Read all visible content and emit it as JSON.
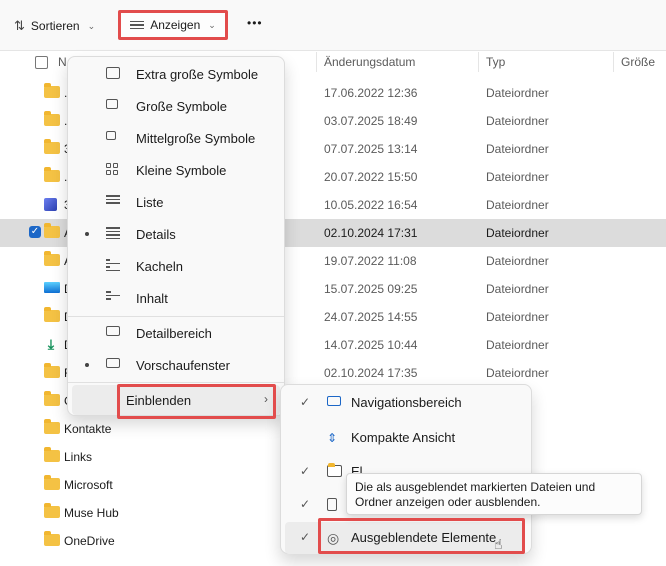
{
  "toolbar": {
    "sort_label": "Sortieren",
    "view_label": "Anzeigen",
    "more_label": "•••"
  },
  "columns": {
    "name": "N",
    "date": "Änderungsdatum",
    "type": "Typ",
    "size": "Größe"
  },
  "rows": [
    {
      "name": ".",
      "date": "17.06.2022 12:36",
      "type": "Dateiordner",
      "icon": "folder-icon"
    },
    {
      "name": ".",
      "date": "03.07.2025 18:49",
      "type": "Dateiordner",
      "icon": "folder-icon"
    },
    {
      "name": "3",
      "date": "07.07.2025 13:14",
      "type": "Dateiordner",
      "icon": "folder-icon"
    },
    {
      "name": ".",
      "date": "20.07.2022 15:50",
      "type": "Dateiordner",
      "icon": "folder-icon"
    },
    {
      "name": "3",
      "date": "10.05.2022 16:54",
      "type": "Dateiordner",
      "icon": "cube-icon"
    },
    {
      "name": "A",
      "date": "02.10.2024 17:31",
      "type": "Dateiordner",
      "icon": "folder-icon"
    },
    {
      "name": "A",
      "date": "19.07.2022 11:08",
      "type": "Dateiordner",
      "icon": "folder-icon"
    },
    {
      "name": "D",
      "date": "15.07.2025 09:25",
      "type": "Dateiordner",
      "icon": "desktop-icon"
    },
    {
      "name": "D",
      "date": "24.07.2025 14:55",
      "type": "Dateiordner",
      "icon": "folder-icon"
    },
    {
      "name": "D",
      "date": "14.07.2025 10:44",
      "type": "Dateiordner",
      "icon": "download-icon"
    },
    {
      "name": "F",
      "date": "02.10.2024 17:35",
      "type": "Dateiordner",
      "icon": "folder-icon"
    },
    {
      "name": "G",
      "date": "",
      "type": "",
      "icon": "folder-icon"
    },
    {
      "name": "Kontakte",
      "date": "",
      "type": "",
      "icon": "folder-icon"
    },
    {
      "name": "Links",
      "date": "",
      "type": "",
      "icon": "folder-icon"
    },
    {
      "name": "Microsoft",
      "date": "",
      "type": "",
      "icon": "folder-icon"
    },
    {
      "name": "Muse Hub",
      "date": "",
      "type": "",
      "icon": "folder-icon"
    },
    {
      "name": "OneDrive",
      "date": "",
      "type": "",
      "icon": "folder-icon"
    }
  ],
  "view_menu": {
    "items": [
      {
        "label": "Extra große Symbole"
      },
      {
        "label": "Große Symbole"
      },
      {
        "label": "Mittelgroße Symbole"
      },
      {
        "label": "Kleine Symbole"
      },
      {
        "label": "Liste"
      },
      {
        "label": "Details"
      },
      {
        "label": "Kacheln"
      },
      {
        "label": "Inhalt"
      },
      {
        "label": "Detailbereich"
      },
      {
        "label": "Vorschaufenster"
      },
      {
        "label": "Einblenden"
      }
    ]
  },
  "show_menu": {
    "items": [
      {
        "label": "Navigationsbereich"
      },
      {
        "label": "Kompakte Ansicht"
      },
      {
        "label": "El..."
      },
      {
        "label": ""
      },
      {
        "label": "Ausgeblendete Elemente"
      }
    ]
  },
  "tooltip": {
    "text": "Die als ausgeblendet markierten Dateien und Ordner anzeigen oder ausblenden."
  },
  "colors": {
    "highlight": "#e24c4c",
    "accent": "#1c67c7",
    "selected_row": "#dcdcdc"
  }
}
